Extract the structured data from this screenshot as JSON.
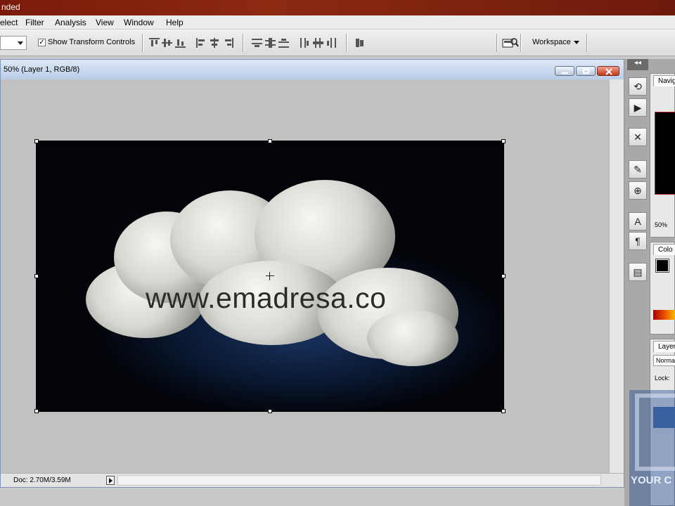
{
  "app": {
    "title": "nded"
  },
  "menu": {
    "items": [
      "elect",
      "Filter",
      "Analysis",
      "View",
      "Window",
      "Help"
    ]
  },
  "options": {
    "show_transform_controls_label": "Show Transform Controls",
    "checkbox_mark": "✓",
    "workspace_label": "Workspace"
  },
  "document": {
    "title": "50% (Layer 1, RGB/8)",
    "status": "Doc: 2.70M/3.59M",
    "watermark_text": "www.emadresa.co"
  },
  "panels": {
    "navigator": {
      "tab": "Navig",
      "zoom": "50%"
    },
    "color": {
      "tab": "Colo"
    },
    "layers": {
      "tab": "Layer",
      "blend_mode": "Norma",
      "lock_label": "Lock:"
    }
  },
  "overlay": {
    "logo_text": "YOUR C"
  },
  "dock": {
    "collapse_label": "◂◂"
  },
  "colors": {
    "title_bar": "#7a1a0a",
    "image_bg": "#020409",
    "accent": "#c02020"
  }
}
